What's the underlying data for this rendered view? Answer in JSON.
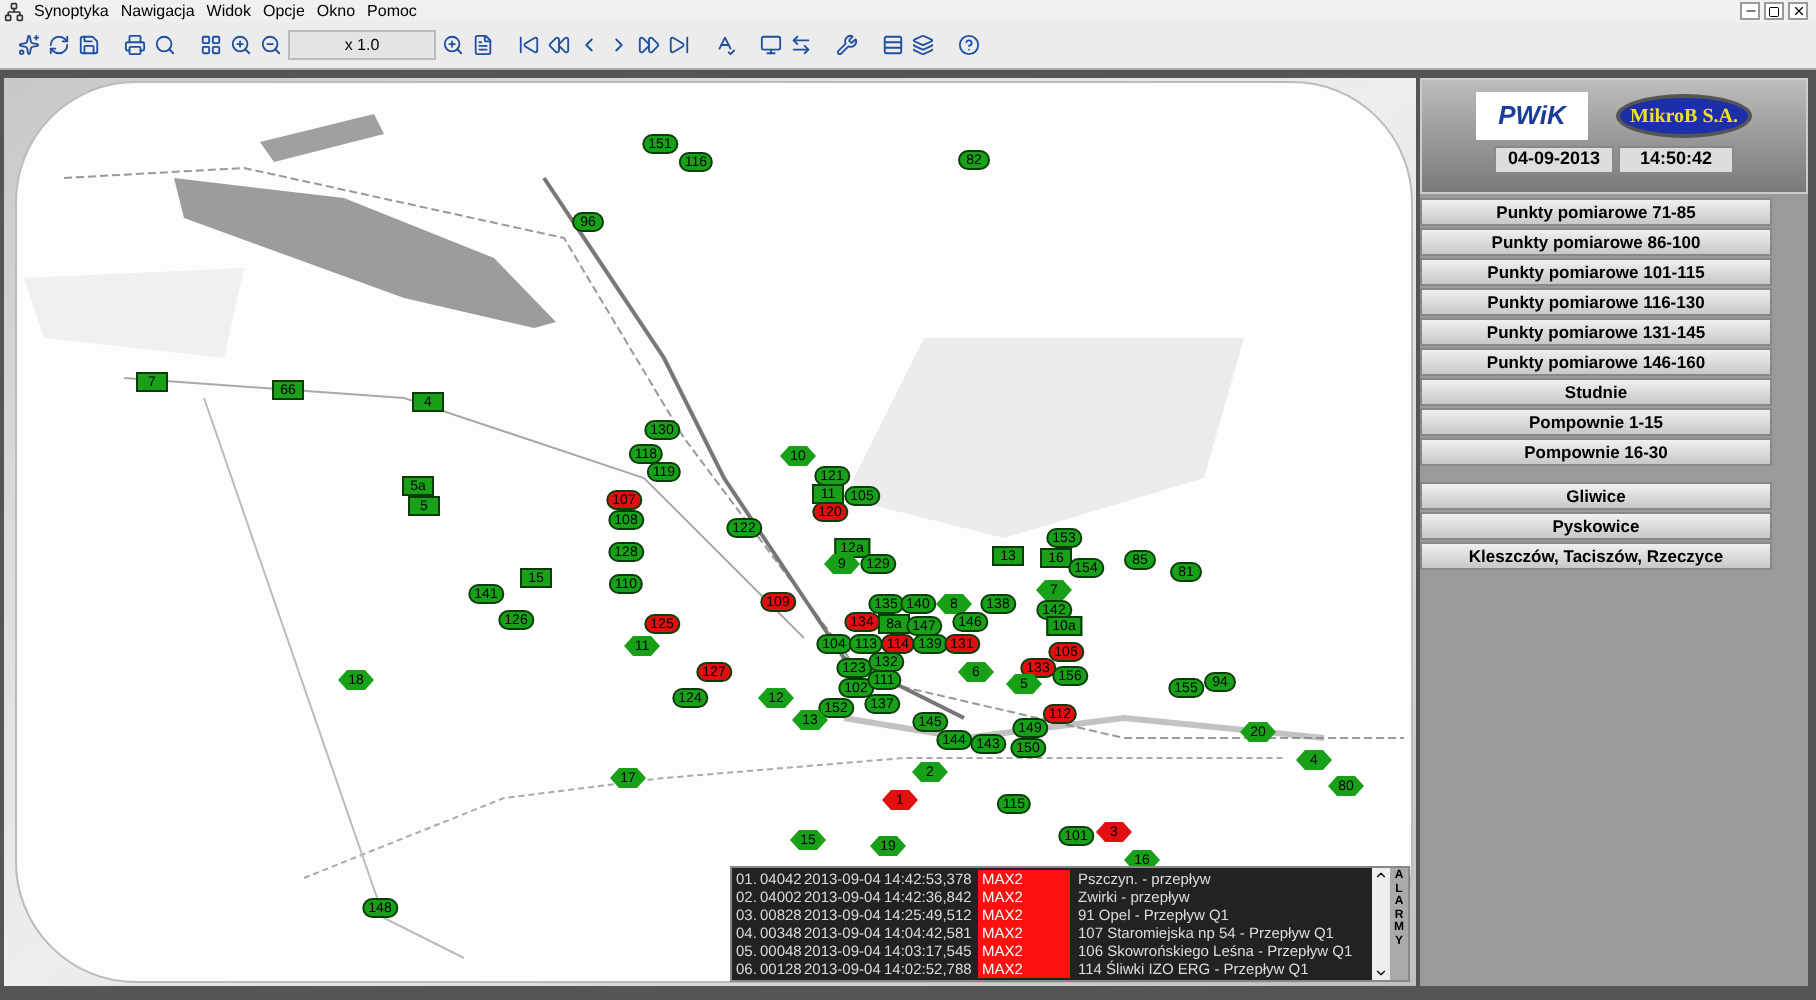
{
  "menu": [
    "Synoptyka",
    "Nawigacja",
    "Widok",
    "Opcje",
    "Okno",
    "Pomoc"
  ],
  "toolbar": {
    "zoom": "x 1.0"
  },
  "markers": [
    {
      "label": "151",
      "color": "#18a018",
      "kind": "oval"
    },
    {
      "label": "116",
      "color": "#18a018",
      "kind": "oval"
    },
    {
      "label": "96",
      "color": "#18a018",
      "kind": "oval"
    },
    {
      "label": "7",
      "color": "#18a018",
      "kind": "rect"
    },
    {
      "label": "66",
      "color": "#18a018",
      "kind": "rect"
    },
    {
      "label": "4",
      "color": "#18a018",
      "kind": "rect"
    },
    {
      "label": "130",
      "color": "#18a018",
      "kind": "oval"
    },
    {
      "label": "118",
      "color": "#18a018",
      "kind": "oval"
    },
    {
      "label": "119",
      "color": "#18a018",
      "kind": "oval"
    },
    {
      "label": "107",
      "color": "#e01010",
      "kind": "oval"
    },
    {
      "label": "108",
      "color": "#18a018",
      "kind": "oval"
    },
    {
      "label": "128",
      "color": "#18a018",
      "kind": "oval"
    },
    {
      "label": "5a",
      "color": "#18a018",
      "kind": "rect"
    },
    {
      "label": "5",
      "color": "#18a018",
      "kind": "rect"
    },
    {
      "label": "15",
      "color": "#18a018",
      "kind": "rect"
    },
    {
      "label": "110",
      "color": "#18a018",
      "kind": "oval"
    },
    {
      "label": "141",
      "color": "#18a018",
      "kind": "oval"
    },
    {
      "label": "126",
      "color": "#18a018",
      "kind": "oval"
    },
    {
      "label": "125",
      "color": "#e01010",
      "kind": "oval"
    },
    {
      "label": "11",
      "color": "#18a018",
      "kind": "hex"
    },
    {
      "label": "124",
      "color": "#18a018",
      "kind": "oval"
    },
    {
      "label": "127",
      "color": "#e01010",
      "kind": "oval"
    },
    {
      "label": "18",
      "color": "#18a018",
      "kind": "hex"
    },
    {
      "label": "17",
      "color": "#18a018",
      "kind": "hex"
    },
    {
      "label": "148",
      "color": "#18a018",
      "kind": "oval"
    },
    {
      "label": "82",
      "color": "#18a018",
      "kind": "oval"
    },
    {
      "label": "10",
      "color": "#18a018",
      "kind": "hex"
    },
    {
      "label": "121",
      "color": "#18a018",
      "kind": "oval"
    },
    {
      "label": "11",
      "color": "#18a018",
      "kind": "rect"
    },
    {
      "label": "105",
      "color": "#18a018",
      "kind": "oval"
    },
    {
      "label": "120",
      "color": "#e01010",
      "kind": "oval"
    },
    {
      "label": "122",
      "color": "#18a018",
      "kind": "oval"
    },
    {
      "label": "12a",
      "color": "#18a018",
      "kind": "rect"
    },
    {
      "label": "9",
      "color": "#18a018",
      "kind": "hex"
    },
    {
      "label": "129",
      "color": "#18a018",
      "kind": "oval"
    },
    {
      "label": "13",
      "color": "#18a018",
      "kind": "rect"
    },
    {
      "label": "153",
      "color": "#18a018",
      "kind": "oval"
    },
    {
      "label": "16",
      "color": "#18a018",
      "kind": "rect"
    },
    {
      "label": "154",
      "color": "#18a018",
      "kind": "oval"
    },
    {
      "label": "85",
      "color": "#18a018",
      "kind": "oval"
    },
    {
      "label": "81",
      "color": "#18a018",
      "kind": "oval"
    },
    {
      "label": "109",
      "color": "#e01010",
      "kind": "oval"
    },
    {
      "label": "135",
      "color": "#18a018",
      "kind": "oval"
    },
    {
      "label": "140",
      "color": "#18a018",
      "kind": "oval"
    },
    {
      "label": "8",
      "color": "#18a018",
      "kind": "hex"
    },
    {
      "label": "138",
      "color": "#18a018",
      "kind": "oval"
    },
    {
      "label": "7",
      "color": "#18a018",
      "kind": "hex"
    },
    {
      "label": "142",
      "color": "#18a018",
      "kind": "oval"
    },
    {
      "label": "134",
      "color": "#e01010",
      "kind": "oval"
    },
    {
      "label": "8a",
      "color": "#18a018",
      "kind": "rect"
    },
    {
      "label": "147",
      "color": "#18a018",
      "kind": "oval"
    },
    {
      "label": "146",
      "color": "#18a018",
      "kind": "oval"
    },
    {
      "label": "10a",
      "color": "#18a018",
      "kind": "rect"
    },
    {
      "label": "104",
      "color": "#18a018",
      "kind": "oval"
    },
    {
      "label": "113",
      "color": "#18a018",
      "kind": "oval"
    },
    {
      "label": "114",
      "color": "#e01010",
      "kind": "oval"
    },
    {
      "label": "139",
      "color": "#18a018",
      "kind": "oval"
    },
    {
      "label": "131",
      "color": "#e01010",
      "kind": "oval"
    },
    {
      "label": "106",
      "color": "#e01010",
      "kind": "oval"
    },
    {
      "label": "123",
      "color": "#18a018",
      "kind": "oval"
    },
    {
      "label": "132",
      "color": "#18a018",
      "kind": "oval"
    },
    {
      "label": "6",
      "color": "#18a018",
      "kind": "hex"
    },
    {
      "label": "133",
      "color": "#e01010",
      "kind": "oval"
    },
    {
      "label": "156",
      "color": "#18a018",
      "kind": "oval"
    },
    {
      "label": "102",
      "color": "#18a018",
      "kind": "oval"
    },
    {
      "label": "111",
      "color": "#18a018",
      "kind": "oval"
    },
    {
      "label": "5",
      "color": "#18a018",
      "kind": "hex"
    },
    {
      "label": "155",
      "color": "#18a018",
      "kind": "oval"
    },
    {
      "label": "94",
      "color": "#18a018",
      "kind": "oval"
    },
    {
      "label": "12",
      "color": "#18a018",
      "kind": "hex"
    },
    {
      "label": "152",
      "color": "#18a018",
      "kind": "oval"
    },
    {
      "label": "137",
      "color": "#18a018",
      "kind": "oval"
    },
    {
      "label": "112",
      "color": "#e01010",
      "kind": "oval"
    },
    {
      "label": "13",
      "color": "#18a018",
      "kind": "hex"
    },
    {
      "label": "145",
      "color": "#18a018",
      "kind": "oval"
    },
    {
      "label": "149",
      "color": "#18a018",
      "kind": "oval"
    },
    {
      "label": "20",
      "color": "#18a018",
      "kind": "hex"
    },
    {
      "label": "144",
      "color": "#18a018",
      "kind": "oval"
    },
    {
      "label": "143",
      "color": "#18a018",
      "kind": "oval"
    },
    {
      "label": "150",
      "color": "#18a018",
      "kind": "oval"
    },
    {
      "label": "4",
      "color": "#18a018",
      "kind": "hex"
    },
    {
      "label": "2",
      "color": "#18a018",
      "kind": "hex"
    },
    {
      "label": "80",
      "color": "#18a018",
      "kind": "hex"
    },
    {
      "label": "1",
      "color": "#e01010",
      "kind": "hex"
    },
    {
      "label": "115",
      "color": "#18a018",
      "kind": "oval"
    },
    {
      "label": "101",
      "color": "#18a018",
      "kind": "oval"
    },
    {
      "label": "3",
      "color": "#e01010",
      "kind": "hex"
    },
    {
      "label": "15",
      "color": "#18a018",
      "kind": "hex"
    },
    {
      "label": "19",
      "color": "#18a018",
      "kind": "hex"
    },
    {
      "label": "16",
      "color": "#18a018",
      "kind": "hex"
    }
  ],
  "alarms": {
    "side_label": "ALARMY",
    "rows": [
      {
        "number": "01.",
        "code": "04042",
        "date": "2013-09-04",
        "time": "14:42:53,378",
        "level": "MAX2",
        "description": "Pszczyn. - przepływ"
      },
      {
        "number": "02.",
        "code": "04002",
        "date": "2013-09-04",
        "time": "14:42:36,842",
        "level": "MAX2",
        "description": "Zwirki - przepływ"
      },
      {
        "number": "03.",
        "code": "00828",
        "date": "2013-09-04",
        "time": "14:25:49,512",
        "level": "MAX2",
        "description": "91 Opel - Przepływ Q1"
      },
      {
        "number": "04.",
        "code": "00348",
        "date": "2013-09-04",
        "time": "14:04:42,581",
        "level": "MAX2",
        "description": "107 Staromiejska np 54 - Przepływ Q1"
      },
      {
        "number": "05.",
        "code": "00048",
        "date": "2013-09-04",
        "time": "14:03:17,545",
        "level": "MAX2",
        "description": "106 Skowrońskiego Leśna - Przepływ Q1"
      },
      {
        "number": "06.",
        "code": "00128",
        "date": "2013-09-04",
        "time": "14:02:52,788",
        "level": "MAX2",
        "description": "114 Śliwki IZO ERG - Przepływ Q1"
      }
    ]
  },
  "side_panel": {
    "logos": [
      "PWiK",
      "MikroB S.A."
    ],
    "date": "04-09-2013",
    "time": "14:50:42",
    "groups": [
      [
        "Punkty pomiarowe 71-85",
        "Punkty pomiarowe 86-100",
        "Punkty pomiarowe 101-115",
        "Punkty pomiarowe 116-130",
        "Punkty pomiarowe 131-145",
        "Punkty pomiarowe 146-160",
        "Studnie",
        "Pompownie 1-15",
        "Pompownie 16-30"
      ],
      [
        "Gliwice",
        "Pyskowice",
        "Kleszczów, Taciszów, Rzeczyce"
      ]
    ]
  }
}
